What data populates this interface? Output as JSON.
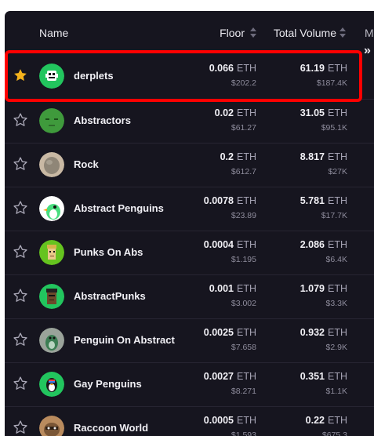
{
  "table": {
    "headers": {
      "name": "Name",
      "floor": "Floor",
      "volume": "Total Volume",
      "more": "M"
    },
    "unit": "ETH",
    "rows": [
      {
        "name": "derplets",
        "favorited": true,
        "floor": "0.066",
        "floor_usd": "$202.2",
        "volume": "61.19",
        "volume_usd": "$187.4K",
        "avatar": "derplets-avatar"
      },
      {
        "name": "Abstractors",
        "favorited": false,
        "floor": "0.02",
        "floor_usd": "$61.27",
        "volume": "31.05",
        "volume_usd": "$95.1K",
        "avatar": "abstractors-avatar"
      },
      {
        "name": "Rock",
        "favorited": false,
        "floor": "0.2",
        "floor_usd": "$612.7",
        "volume": "8.817",
        "volume_usd": "$27K",
        "avatar": "rock-avatar"
      },
      {
        "name": "Abstract Penguins",
        "favorited": false,
        "floor": "0.0078",
        "floor_usd": "$23.89",
        "volume": "5.781",
        "volume_usd": "$17.7K",
        "avatar": "abstract-penguins-avatar"
      },
      {
        "name": "Punks On Abs",
        "favorited": false,
        "floor": "0.0004",
        "floor_usd": "$1.195",
        "volume": "2.086",
        "volume_usd": "$6.4K",
        "avatar": "punks-on-abs-avatar"
      },
      {
        "name": "AbstractPunks",
        "favorited": false,
        "floor": "0.001",
        "floor_usd": "$3.002",
        "volume": "1.079",
        "volume_usd": "$3.3K",
        "avatar": "abstractpunks-avatar"
      },
      {
        "name": "Penguin On Abstract",
        "favorited": false,
        "floor": "0.0025",
        "floor_usd": "$7.658",
        "volume": "0.932",
        "volume_usd": "$2.9K",
        "avatar": "penguin-on-abstract-avatar"
      },
      {
        "name": "Gay Penguins",
        "favorited": false,
        "floor": "0.0027",
        "floor_usd": "$8.271",
        "volume": "0.351",
        "volume_usd": "$1.1K",
        "avatar": "gay-penguins-avatar"
      },
      {
        "name": "Raccoon World",
        "favorited": false,
        "floor": "0.0005",
        "floor_usd": "$1.593",
        "volume": "0.22",
        "volume_usd": "$675.3",
        "avatar": "raccoon-world-avatar"
      }
    ]
  },
  "icons": {
    "star_filled": "star-filled-icon",
    "star_outline": "star-outline-icon",
    "more": "chevrons-right-icon",
    "sort": "sort-icon"
  },
  "colors": {
    "background": "#16151f",
    "highlight": "#ff0000",
    "star_gold": "#f5b31c",
    "star_outline": "#a9a7b6",
    "text": "#f1f0f5",
    "muted": "#8e8c9c"
  }
}
